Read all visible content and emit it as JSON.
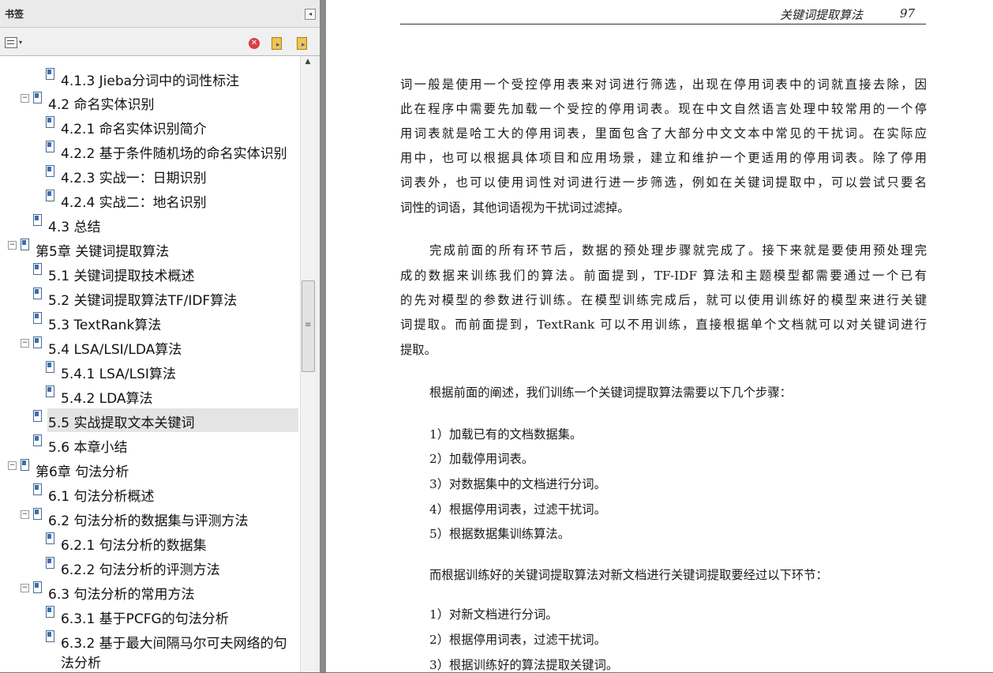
{
  "sidebar": {
    "title": "书签",
    "collapse_icon": "◂",
    "delete_icon": "✕",
    "tree": [
      {
        "label": "4.1.3 Jieba分词中的词性标注",
        "level": 2,
        "expandable": false,
        "selected": false
      },
      {
        "label": "4.2 命名实体识别",
        "level": 1,
        "expandable": true,
        "selected": false
      },
      {
        "label": "4.2.1 命名实体识别简介",
        "level": 2,
        "expandable": false,
        "selected": false
      },
      {
        "label": "4.2.2 基于条件随机场的命名实体识别",
        "level": 2,
        "expandable": false,
        "selected": false
      },
      {
        "label": "4.2.3 实战一：日期识别",
        "level": 2,
        "expandable": false,
        "selected": false
      },
      {
        "label": "4.2.4 实战二：地名识别",
        "level": 2,
        "expandable": false,
        "selected": false
      },
      {
        "label": "4.3 总结",
        "level": 1,
        "expandable": false,
        "selected": false
      },
      {
        "label": "第5章 关键词提取算法",
        "level": 0,
        "expandable": true,
        "selected": false
      },
      {
        "label": "5.1 关键词提取技术概述",
        "level": 1,
        "expandable": false,
        "selected": false
      },
      {
        "label": "5.2 关键词提取算法TF/IDF算法",
        "level": 1,
        "expandable": false,
        "selected": false
      },
      {
        "label": "5.3 TextRank算法",
        "level": 1,
        "expandable": false,
        "selected": false
      },
      {
        "label": "5.4 LSA/LSI/LDA算法",
        "level": 1,
        "expandable": true,
        "selected": false
      },
      {
        "label": "5.4.1 LSA/LSI算法",
        "level": 2,
        "expandable": false,
        "selected": false
      },
      {
        "label": "5.4.2 LDA算法",
        "level": 2,
        "expandable": false,
        "selected": false
      },
      {
        "label": "5.5 实战提取文本关键词",
        "level": 1,
        "expandable": false,
        "selected": true
      },
      {
        "label": "5.6 本章小结",
        "level": 1,
        "expandable": false,
        "selected": false
      },
      {
        "label": "第6章 句法分析",
        "level": 0,
        "expandable": true,
        "selected": false
      },
      {
        "label": "6.1 句法分析概述",
        "level": 1,
        "expandable": false,
        "selected": false
      },
      {
        "label": "6.2 句法分析的数据集与评测方法",
        "level": 1,
        "expandable": true,
        "selected": false
      },
      {
        "label": "6.2.1 句法分析的数据集",
        "level": 2,
        "expandable": false,
        "selected": false
      },
      {
        "label": "6.2.2 句法分析的评测方法",
        "level": 2,
        "expandable": false,
        "selected": false
      },
      {
        "label": "6.3 句法分析的常用方法",
        "level": 1,
        "expandable": true,
        "selected": false
      },
      {
        "label": "6.3.1 基于PCFG的句法分析",
        "level": 2,
        "expandable": false,
        "selected": false
      },
      {
        "label": "6.3.2 基于最大间隔马尔可夫网络的句",
        "level": 2,
        "expandable": false,
        "selected": false
      },
      {
        "label": "法分析",
        "level": 2,
        "expandable": false,
        "selected": false,
        "continuation": true
      }
    ]
  },
  "page": {
    "running_title": "关键词提取算法",
    "page_number": "97",
    "lines": [
      "词一般是使用一个受控停用表来对词进行筛选，出现在停用词表中的词就直接去除，因",
      "此在程序中需要先加载一个受控的停用词表。现在中文自然语言处理中较常用的一个停",
      "用词表就是哈工大的停用词表，里面包含了大部分中文文本中常见的干扰词。在实际应",
      "用中，也可以根据具体项目和应用场景，建立和维护一个更适用的停用词表。除了停用",
      "词表外，也可以使用词性对词进行进一步筛选，例如在关键词提取中，可以尝试只要名",
      "词性的词语，其他词语视为干扰词过滤掉。",
      "完成前面的所有环节后，数据的预处理步骤就完成了。接下来就是要使用预处理完",
      "成的数据来训练我们的算法。前面提到，TF-IDF 算法和主题模型都需要通过一个已有",
      "的先对模型的参数进行训练。在模型训练完成后，就可以使用训练好的模型来进行关键",
      "词提取。而前面提到，TextRank 可以不用训练，直接根据单个文档就可以对关键词进行",
      "提取。",
      "根据前面的阐述，我们训练一个关键词提取算法需要以下几个步骤：",
      "1）加载已有的文档数据集。",
      "2）加载停用词表。",
      "3）对数据集中的文档进行分词。",
      "4）根据停用词表，过滤干扰词。",
      "5）根据数据集训练算法。",
      "而根据训练好的关键词提取算法对新文档进行关键词提取要经过以下环节：",
      "1）对新文档进行分词。",
      "2）根据停用词表，过滤干扰词。",
      "3）根据训练好的算法提取关键词。"
    ]
  }
}
